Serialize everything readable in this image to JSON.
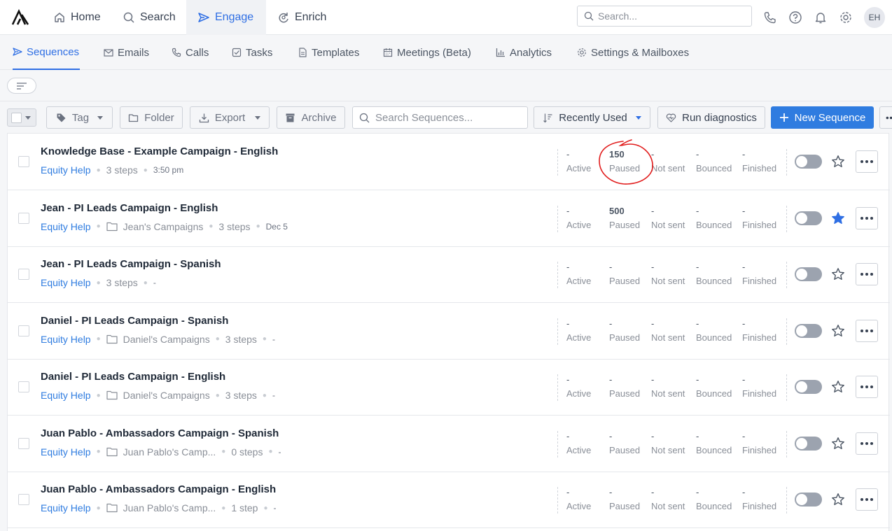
{
  "nav": {
    "items": [
      {
        "label": "Home",
        "icon": "home-icon"
      },
      {
        "label": "Search",
        "icon": "search-icon"
      },
      {
        "label": "Engage",
        "icon": "send-icon",
        "active": true
      },
      {
        "label": "Enrich",
        "icon": "refresh-icon"
      }
    ],
    "search_placeholder": "Search...",
    "avatar": "EH"
  },
  "subnav": {
    "items": [
      {
        "label": "Sequences",
        "active": true
      },
      {
        "label": "Emails"
      },
      {
        "label": "Calls"
      },
      {
        "label": "Tasks"
      },
      {
        "label": "Templates"
      },
      {
        "label": "Meetings (Beta)"
      },
      {
        "label": "Analytics"
      },
      {
        "label": "Settings & Mailboxes"
      }
    ]
  },
  "toolbar": {
    "tag": "Tag",
    "folder": "Folder",
    "export": "Export",
    "archive": "Archive",
    "search_placeholder": "Search Sequences...",
    "sort": "Recently Used",
    "diagnostics": "Run diagnostics",
    "new_sequence": "New Sequence"
  },
  "stat_labels": [
    "Active",
    "Paused",
    "Not sent",
    "Bounced",
    "Finished"
  ],
  "rows": [
    {
      "title": "Knowledge Base - Example Campaign - English",
      "team": "Equity Help",
      "folder": "",
      "steps": "3 steps",
      "when": "3:50 pm",
      "stats": [
        "-",
        "150",
        "-",
        "-",
        "-"
      ],
      "starred": false,
      "enabled": false
    },
    {
      "title": "Jean - PI Leads Campaign - English",
      "team": "Equity Help",
      "folder": "Jean's Campaigns",
      "steps": "3 steps",
      "when": "Dec 5",
      "stats": [
        "-",
        "500",
        "-",
        "-",
        "-"
      ],
      "starred": true,
      "enabled": false
    },
    {
      "title": "Jean - PI Leads Campaign - Spanish",
      "team": "Equity Help",
      "folder": "",
      "steps": "3 steps",
      "when": "-",
      "stats": [
        "-",
        "-",
        "-",
        "-",
        "-"
      ],
      "starred": false,
      "enabled": false
    },
    {
      "title": "Daniel - PI Leads Campaign - Spanish",
      "team": "Equity Help",
      "folder": "Daniel's Campaigns",
      "steps": "3 steps",
      "when": "-",
      "stats": [
        "-",
        "-",
        "-",
        "-",
        "-"
      ],
      "starred": false,
      "enabled": false
    },
    {
      "title": "Daniel - PI Leads Campaign - English",
      "team": "Equity Help",
      "folder": "Daniel's Campaigns",
      "steps": "3 steps",
      "when": "-",
      "stats": [
        "-",
        "-",
        "-",
        "-",
        "-"
      ],
      "starred": false,
      "enabled": false
    },
    {
      "title": "Juan Pablo - Ambassadors Campaign - Spanish",
      "team": "Equity Help",
      "folder": "Juan Pablo's Camp...",
      "steps": "0 steps",
      "when": "-",
      "stats": [
        "-",
        "-",
        "-",
        "-",
        "-"
      ],
      "starred": false,
      "enabled": false
    },
    {
      "title": "Juan Pablo - Ambassadors Campaign - English",
      "team": "Equity Help",
      "folder": "Juan Pablo's Camp...",
      "steps": "1 step",
      "when": "-",
      "stats": [
        "-",
        "-",
        "-",
        "-",
        "-"
      ],
      "starred": false,
      "enabled": false
    }
  ],
  "colors": {
    "accent": "#2f6fe4",
    "primary_button": "#2f7ce0",
    "annotation": "#e11d1d"
  }
}
